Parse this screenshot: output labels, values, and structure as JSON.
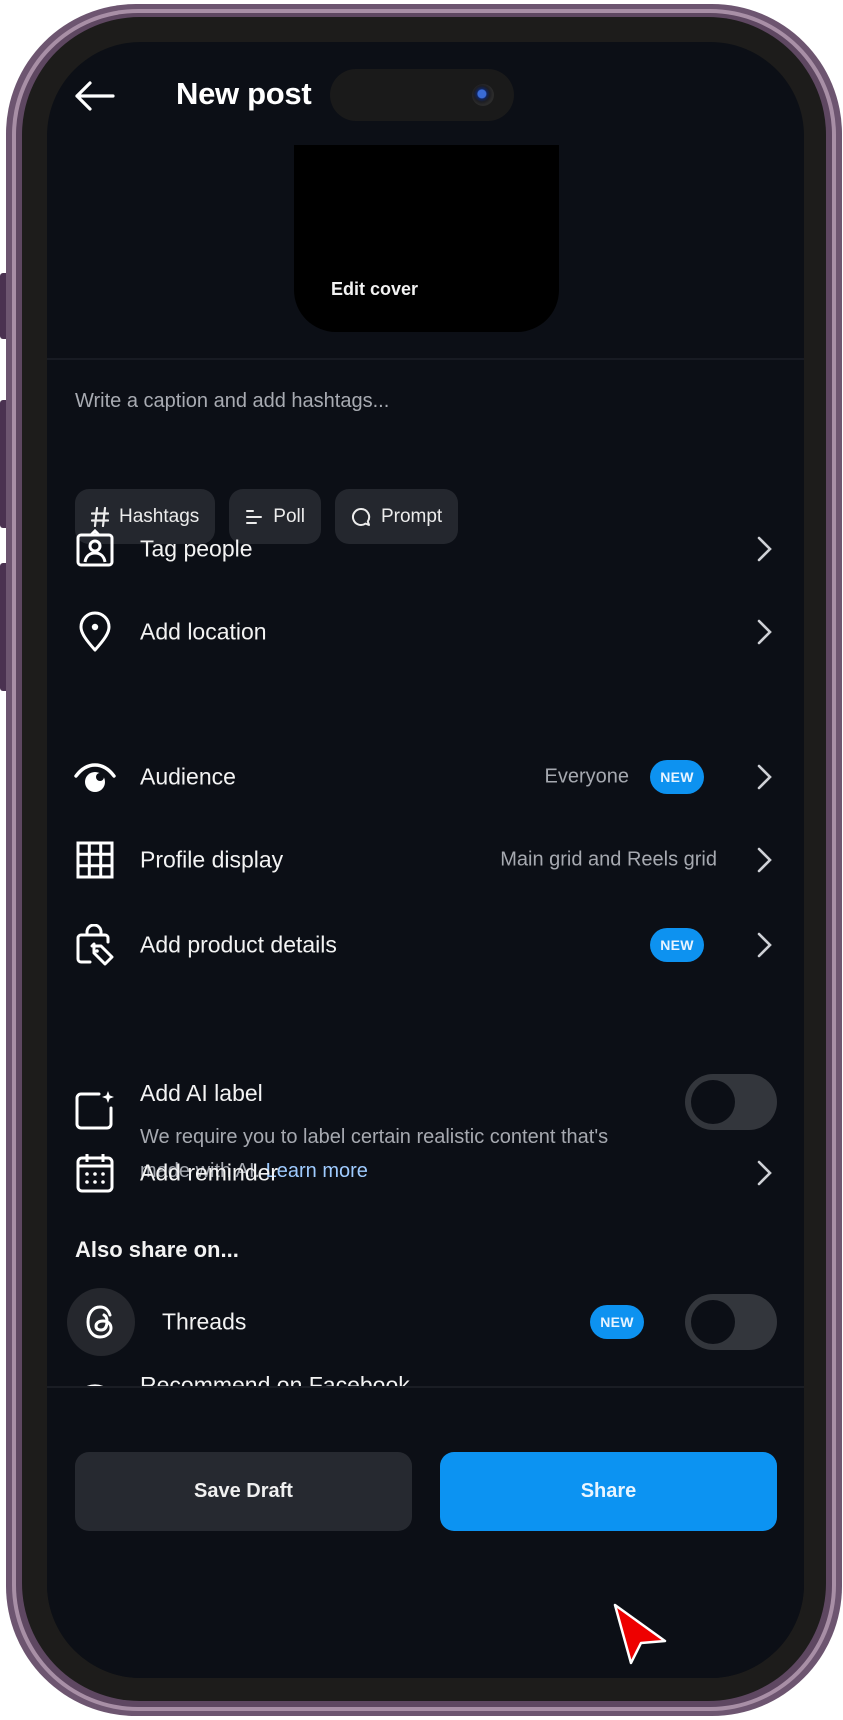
{
  "header": {
    "title": "New post",
    "back_icon": "arrow-left-icon"
  },
  "cover": {
    "label": "Edit cover"
  },
  "caption": {
    "placeholder": "Write a caption and add hashtags...",
    "value": ""
  },
  "chips": [
    {
      "label": "Hashtags",
      "icon": "hash-icon"
    },
    {
      "label": "Poll",
      "icon": "poll-icon"
    },
    {
      "label": "Prompt",
      "icon": "prompt-bubble-icon"
    }
  ],
  "rows": {
    "tag_people": {
      "label": "Tag people",
      "icon": "tag-person-icon"
    },
    "add_location": {
      "label": "Add location",
      "icon": "location-pin-icon"
    },
    "audience": {
      "label": "Audience",
      "value": "Everyone",
      "badge": "NEW",
      "icon": "eye-icon"
    },
    "profile_display": {
      "label": "Profile display",
      "value": "Main grid and Reels grid",
      "icon": "grid-icon"
    },
    "product_details": {
      "label": "Add product details",
      "badge": "NEW",
      "icon": "shopping-tag-icon"
    },
    "ai_label": {
      "label": "Add AI label",
      "description": "We require you to label certain realistic content that's made with AI.",
      "link": "Learn more",
      "toggle_on": false,
      "icon": "ai-sparkle-icon"
    },
    "reminder": {
      "label": "Add reminder",
      "icon": "calendar-icon"
    }
  },
  "also_share": {
    "heading": "Also share on...",
    "threads": {
      "label": "Threads",
      "badge": "NEW",
      "toggle_on": false,
      "icon": "threads-icon"
    },
    "facebook": {
      "label": "Recommend on Facebook",
      "toggle_on": false,
      "icon": "facebook-icon"
    }
  },
  "footer": {
    "save_draft": "Save Draft",
    "share": "Share"
  },
  "colors": {
    "background": "#0c0f16",
    "accent": "#0c93f2",
    "badge": "#0d92f0",
    "link": "#9fcbff",
    "frame": "#6d5570"
  }
}
